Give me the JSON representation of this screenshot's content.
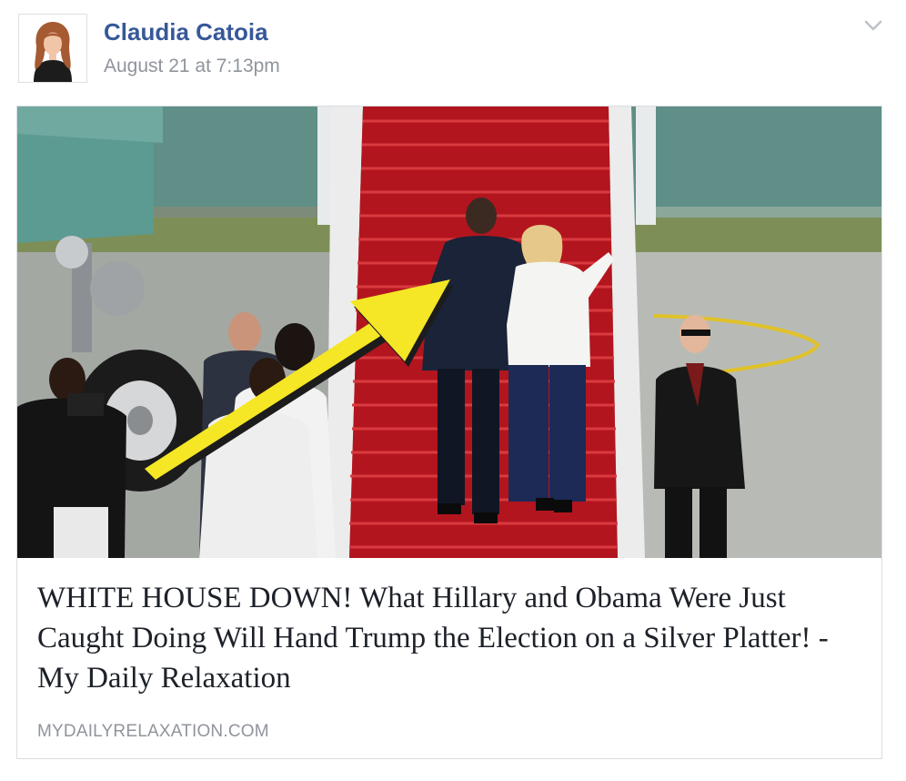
{
  "post": {
    "author_name": "Claudia Catoia",
    "timestamp": "August 21 at 7:13pm",
    "menu_icon": "chevron-down-icon"
  },
  "link_card": {
    "headline": "WHITE HOUSE DOWN! What Hillary and Obama Were Just Caught Doing Will Hand Trump the Election on a Silver Platter! - My Daily Relaxation",
    "domain": "MYDAILYRELAXATION.COM"
  },
  "colors": {
    "author_link": "#365899",
    "meta_text": "#90949c",
    "headline_text": "#1d2129",
    "card_border": "#dadde1",
    "arrow_yellow": "#f5e626",
    "carpet_red": "#b3151e"
  }
}
